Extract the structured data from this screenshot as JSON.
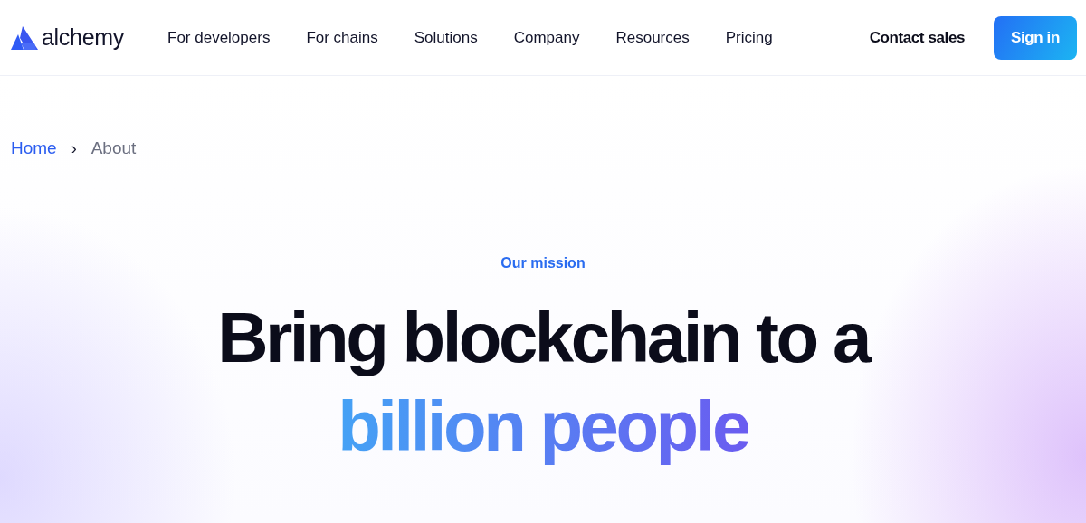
{
  "header": {
    "logo": "alchemy",
    "nav": [
      "For developers",
      "For chains",
      "Solutions",
      "Company",
      "Resources",
      "Pricing"
    ],
    "contact": "Contact sales",
    "sign_in": "Sign in"
  },
  "breadcrumb": [
    {
      "label": "Home",
      "kind": "link"
    },
    {
      "label": "›",
      "kind": "separator"
    },
    {
      "label": "About",
      "kind": "current"
    }
  ],
  "hero": {
    "eyebrow": "Our mission",
    "headline": "Bring blockchain to a",
    "highlight": "billion people"
  }
}
